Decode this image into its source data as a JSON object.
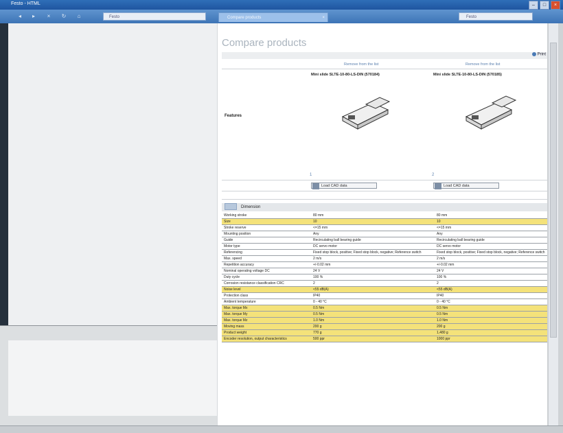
{
  "window": {
    "title": "Festo - HTML"
  },
  "toolbar": {
    "address": "Festo",
    "tab": "Compare products",
    "search": "Festo"
  },
  "page": {
    "title": "Compare products",
    "print_label": "Print",
    "header_links": [
      "Remove from the list",
      "Remove from the list"
    ],
    "features_label": "Features",
    "products": [
      {
        "name": "Mini slide SLTE-10-80-LS-DIN (570184)",
        "mark": "1"
      },
      {
        "name": "Mini slide SLTE-10-80-LS-DIN (570185)",
        "mark": "2"
      }
    ],
    "cad_button": "Load CAD data",
    "section_title": "Dimension"
  },
  "specs": [
    {
      "label": "Working stroke",
      "v1": "80 mm",
      "v2": "80 mm",
      "hl": false
    },
    {
      "label": "Size",
      "v1": "10",
      "v2": "10",
      "hl": true
    },
    {
      "label": "Stroke reserve",
      "v1": "<=15 mm",
      "v2": "<=15 mm",
      "hl": false
    },
    {
      "label": "Mounting position",
      "v1": "Any",
      "v2": "Any",
      "hl": false
    },
    {
      "label": "Guide",
      "v1": "Recirculating ball bearing guide",
      "v2": "Recirculating ball bearing guide",
      "hl": false
    },
    {
      "label": "Motor type",
      "v1": "DC servo motor",
      "v2": "DC servo motor",
      "hl": false
    },
    {
      "label": "Referencing",
      "v1": "Fixed stop block, positive; Fixed stop block, negative; Reference switch",
      "v2": "Fixed stop block, positive; Fixed stop block, negative; Reference switch",
      "hl": false
    },
    {
      "label": "Max. speed",
      "v1": "2 m/s",
      "v2": "2 m/s",
      "hl": false
    },
    {
      "label": "Repetition accuracy",
      "v1": "+/-0.02 mm",
      "v2": "+/-0.02 mm",
      "hl": false
    },
    {
      "label": "Nominal operating voltage DC",
      "v1": "24 V",
      "v2": "24 V",
      "hl": false
    },
    {
      "label": "Duty cycle",
      "v1": "100 %",
      "v2": "100 %",
      "hl": false
    },
    {
      "label": "Corrosion resistance classification CRC",
      "v1": "2",
      "v2": "2",
      "hl": false
    },
    {
      "label": "Noise level",
      "v1": "<55 dB(A)",
      "v2": "<55 dB(A)",
      "hl": true
    },
    {
      "label": "Protection class",
      "v1": "IP40",
      "v2": "IP40",
      "hl": false
    },
    {
      "label": "Ambient temperature",
      "v1": "0 - 40 °C",
      "v2": "0 - 40 °C",
      "hl": false
    },
    {
      "label": "Max. torque Mx",
      "v1": "0.5 Nm",
      "v2": "0.5 Nm",
      "hl": true
    },
    {
      "label": "Max. torque My",
      "v1": "0.5 Nm",
      "v2": "0.5 Nm",
      "hl": true
    },
    {
      "label": "Max. torque Mz",
      "v1": "1.0 Nm",
      "v2": "1.0 Nm",
      "hl": true
    },
    {
      "label": "Moving mass",
      "v1": "200 g",
      "v2": "200 g",
      "hl": true
    },
    {
      "label": "Product weight",
      "v1": "770 g",
      "v2": "1,480 g",
      "hl": true
    },
    {
      "label": "Encoder resolution, output characteristics",
      "v1": "500 ppr",
      "v2": "1000 ppr",
      "hl": true
    }
  ]
}
